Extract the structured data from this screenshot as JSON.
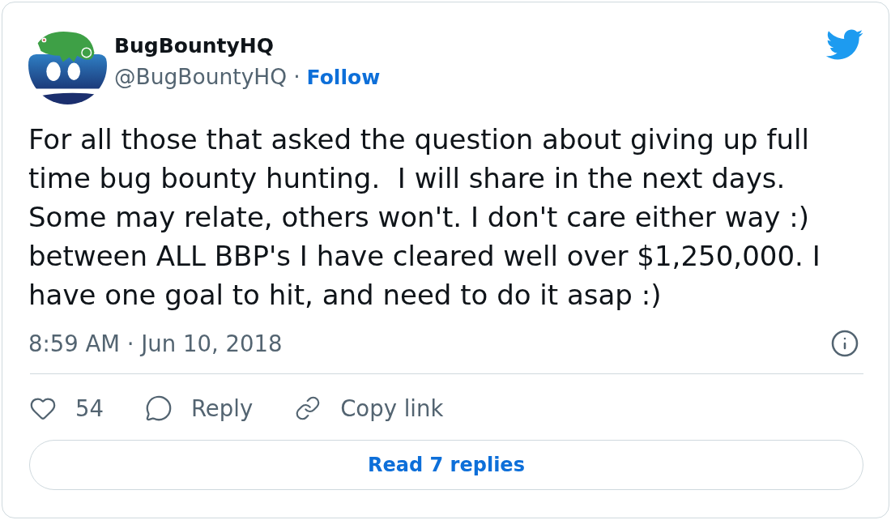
{
  "tweet": {
    "author": {
      "name": "BugBountyHQ",
      "handle": "@BugBountyHQ",
      "separator": "·",
      "follow": "Follow"
    },
    "text": "For all those that asked the question about giving up full time bug bounty hunting.  I will share in the next days. Some may relate, others won't. I don't care either way :)\nbetween ALL BBP's I have cleared well over $1,250,000. I have one goal to hit, and need to do it asap :)",
    "timestamp": "8:59 AM · Jun 10, 2018",
    "actions": [
      {
        "kind": "like",
        "label": "54"
      },
      {
        "kind": "reply",
        "label": "Reply"
      },
      {
        "kind": "copy-link",
        "label": "Copy link"
      }
    ],
    "read_replies": "Read 7 replies"
  }
}
